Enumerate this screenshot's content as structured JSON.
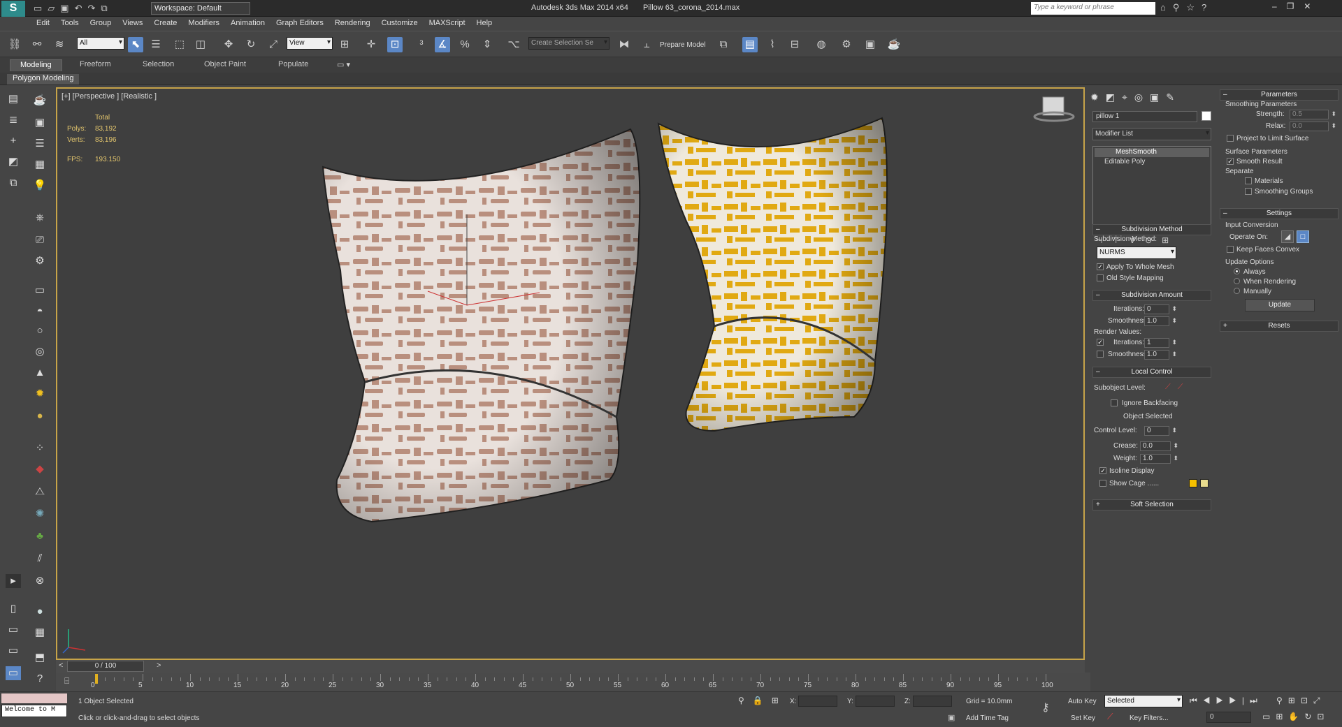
{
  "titlebar": {
    "workspace": "Workspace: Default",
    "app_title": "Autodesk 3ds Max  2014 x64",
    "file_title": "Pillow 63_corona_2014.max",
    "search_placeholder": "Type a keyword or phrase"
  },
  "menu": [
    "Edit",
    "Tools",
    "Group",
    "Views",
    "Create",
    "Modifiers",
    "Animation",
    "Graph Editors",
    "Rendering",
    "Customize",
    "MAXScript",
    "Help"
  ],
  "toolbar": {
    "filter_select": "All",
    "view_select": "View",
    "selection_set": "Create Selection Se",
    "prepare_model": "Prepare Model"
  },
  "ribbon": {
    "tabs": [
      "Modeling",
      "Freeform",
      "Selection",
      "Object Paint",
      "Populate"
    ],
    "sub_label": "Polygon Modeling"
  },
  "viewport": {
    "label": "[+] [Perspective ] [Realistic ]",
    "stats": {
      "total_label": "Total",
      "polys_label": "Polys:",
      "polys": "83,192",
      "verts_label": "Verts:",
      "verts": "83,196",
      "fps_label": "FPS:",
      "fps": "193.150"
    }
  },
  "command_panel": {
    "object_name": "pillow 1",
    "modifier_list": "Modifier List",
    "stack": [
      "MeshSmooth",
      "Editable Poly"
    ],
    "subdivision_method": {
      "title": "Subdivision Method",
      "label": "Subdivision Method:",
      "value": "NURMS",
      "apply_whole_mesh": "Apply To Whole Mesh",
      "old_style": "Old Style Mapping"
    },
    "subdivision_amount": {
      "title": "Subdivision Amount",
      "iterations_label": "Iterations:",
      "iterations": "0",
      "smoothness_label": "Smoothness:",
      "smoothness": "1.0",
      "render_values": "Render Values:",
      "r_iterations_label": "Iterations:",
      "r_iterations": "1",
      "r_smoothness_label": "Smoothness:",
      "r_smoothness": "1.0"
    },
    "local_control": {
      "title": "Local Control",
      "subobject_label": "Subobject Level:",
      "ignore_backfacing": "Ignore Backfacing",
      "object_selected": "Object Selected",
      "control_level_label": "Control Level:",
      "control_level": "0",
      "crease_label": "Crease:",
      "crease": "0.0",
      "weight_label": "Weight:",
      "weight": "1.0",
      "isoline": "Isoline Display",
      "show_cage": "Show Cage ......"
    },
    "soft_selection": {
      "title": "Soft Selection"
    },
    "parameters": {
      "title": "Parameters",
      "smoothing_params": "Smoothing Parameters",
      "strength_label": "Strength:",
      "strength": "0.5",
      "relax_label": "Relax:",
      "relax": "0.0",
      "project_limit": "Project to Limit Surface",
      "surface_params": "Surface Parameters",
      "smooth_result": "Smooth Result",
      "separate": "Separate",
      "materials": "Materials",
      "smoothing_groups": "Smoothing Groups"
    },
    "settings": {
      "title": "Settings",
      "input_conversion": "Input Conversion",
      "operate_on": "Operate On:",
      "keep_faces_convex": "Keep Faces Convex",
      "update_options": "Update Options",
      "always": "Always",
      "when_rendering": "When Rendering",
      "manually": "Manually",
      "update_button": "Update"
    },
    "resets": {
      "title": "Resets"
    }
  },
  "timeline": {
    "frame": "0 / 100",
    "ticks": [
      "0",
      "5",
      "10",
      "15",
      "20",
      "25",
      "30",
      "35",
      "40",
      "45",
      "50",
      "55",
      "60",
      "65",
      "70",
      "75",
      "80",
      "85",
      "90",
      "95",
      "100"
    ]
  },
  "status": {
    "welcome": "Welcome to M",
    "objects_selected": "1 Object Selected",
    "prompt": "Click or click-and-drag to select objects",
    "x_label": "X:",
    "y_label": "Y:",
    "z_label": "Z:",
    "grid": "Grid = 10.0mm",
    "add_time_tag": "Add Time Tag",
    "auto_key": "Auto Key",
    "selected": "Selected",
    "set_key": "Set Key",
    "key_filters": "Key Filters...",
    "frame_value": "0"
  },
  "colors": {
    "accent": "#5b87c6",
    "viewport_border": "#c7a449",
    "stats_text": "#e2c56d",
    "cage_color_1": "#f5c000",
    "cage_color_2": "#e8dc8e"
  }
}
